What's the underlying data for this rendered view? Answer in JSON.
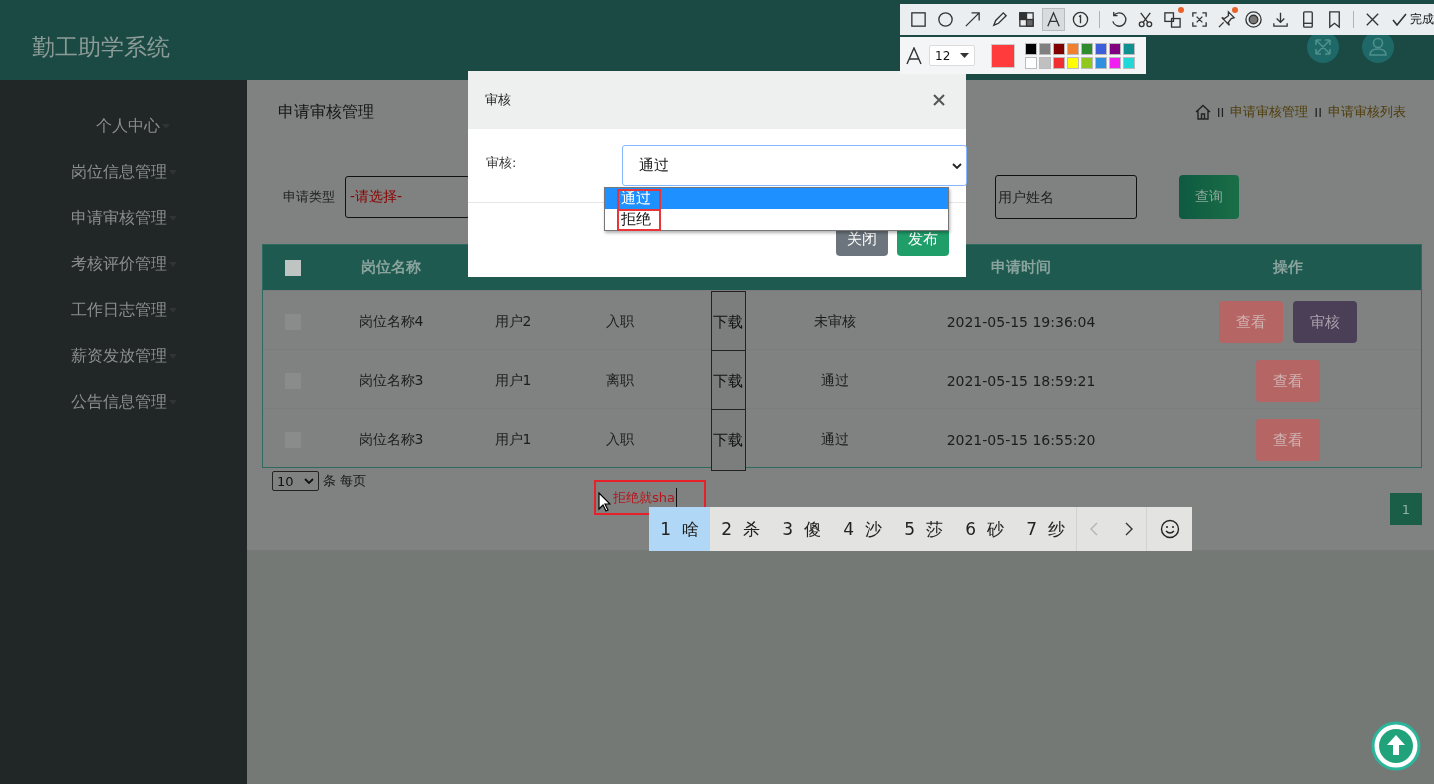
{
  "header": {
    "logo": "勤工助学系统"
  },
  "sidebar": {
    "items": [
      {
        "label": "个人中心"
      },
      {
        "label": "岗位信息管理"
      },
      {
        "label": "申请审核管理"
      },
      {
        "label": "考核评价管理"
      },
      {
        "label": "工作日志管理"
      },
      {
        "label": "薪资发放管理"
      },
      {
        "label": "公告信息管理"
      }
    ]
  },
  "page": {
    "title": "申请审核管理",
    "breadcrumb": [
      {
        "kind": "separator",
        "text": "II"
      },
      {
        "kind": "link",
        "text": "申请审核管理"
      },
      {
        "kind": "separator",
        "text": "II"
      },
      {
        "kind": "link",
        "text": "申请审核列表"
      }
    ]
  },
  "filters": {
    "type_label": "申请类型",
    "type_value": "-请选择-",
    "name_placeholder": "用户姓名",
    "search_button": "查询"
  },
  "table": {
    "select_all_checked": false,
    "columns": [
      "岗位名称",
      "申请时间",
      "操作"
    ],
    "rows": [
      {
        "checked": false,
        "job": "岗位名称4",
        "user": "用户2",
        "type": "入职",
        "download": "下载",
        "status": "未审核",
        "time": "2021-05-15 19:36:04",
        "actions": [
          {
            "kind": "view",
            "label": "查看"
          },
          {
            "kind": "review",
            "label": "审核"
          }
        ]
      },
      {
        "checked": false,
        "job": "岗位名称3",
        "user": "用户1",
        "type": "离职",
        "download": "下载",
        "status": "通过",
        "time": "2021-05-15 18:59:21",
        "actions": [
          {
            "kind": "view",
            "label": "查看"
          }
        ]
      },
      {
        "checked": false,
        "job": "岗位名称3",
        "user": "用户1",
        "type": "入职",
        "download": "下载",
        "status": "通过",
        "time": "2021-05-15 16:55:20",
        "actions": [
          {
            "kind": "view",
            "label": "查看"
          }
        ]
      }
    ]
  },
  "pagination": {
    "page_size": "10",
    "page_size_label": "条 每页",
    "pages": [
      {
        "label": "1",
        "selected": true
      }
    ]
  },
  "modal": {
    "title": "审核",
    "field_label": "审核:",
    "value": "通过",
    "options": [
      {
        "label": "通过",
        "selected": true
      },
      {
        "label": "拒绝",
        "selected": false
      }
    ],
    "buttons": [
      {
        "kind": "secondary",
        "label": "关闭"
      },
      {
        "kind": "primary",
        "label": "发布"
      }
    ]
  },
  "annotation": {
    "text": "拒绝就sha"
  },
  "ime": {
    "candidates": [
      {
        "number": "1",
        "text": "啥",
        "selected": true
      },
      {
        "number": "2",
        "text": "杀",
        "selected": false
      },
      {
        "number": "3",
        "text": "傻",
        "selected": false
      },
      {
        "number": "4",
        "text": "沙",
        "selected": false
      },
      {
        "number": "5",
        "text": "莎",
        "selected": false
      },
      {
        "number": "6",
        "text": "砂",
        "selected": false
      },
      {
        "number": "7",
        "text": "纱",
        "selected": false
      }
    ],
    "prev_disabled": true
  },
  "screenshot_toolbar": {
    "tools": [
      {
        "selected": false,
        "dot": false
      },
      {
        "selected": false,
        "dot": false
      },
      {
        "selected": false,
        "dot": false
      },
      {
        "selected": false,
        "dot": false
      },
      {
        "selected": false,
        "dot": false
      },
      {
        "selected": true,
        "dot": false
      },
      {
        "selected": false,
        "dot": false
      },
      {
        "selected": false,
        "dot": false
      },
      {
        "selected": false,
        "dot": false
      },
      {
        "selected": false,
        "dot": true
      },
      {
        "selected": false,
        "dot": false
      },
      {
        "selected": false,
        "dot": true
      },
      {
        "selected": false,
        "dot": false
      },
      {
        "selected": false,
        "dot": false
      },
      {
        "selected": false,
        "dot": false
      },
      {
        "selected": false,
        "dot": false
      },
      {
        "selected": false,
        "dot": false
      }
    ],
    "done_label": "完成",
    "font_size": "12",
    "current_swatch": {
      "color": "#ff3b3b"
    },
    "palette": [
      {
        "color": "#000000"
      },
      {
        "color": "#808080"
      },
      {
        "color": "#800000"
      },
      {
        "color": "#f08030"
      },
      {
        "color": "#2e8b2e"
      },
      {
        "color": "#3d5fd9"
      },
      {
        "color": "#800080"
      },
      {
        "color": "#109090"
      },
      {
        "color": "#ffffff"
      },
      {
        "color": "#c0c0c0"
      },
      {
        "color": "#f03030"
      },
      {
        "color": "#ffff00"
      },
      {
        "color": "#90c820"
      },
      {
        "color": "#3090e0"
      },
      {
        "color": "#f020f0"
      },
      {
        "color": "#20d8d8"
      }
    ]
  }
}
